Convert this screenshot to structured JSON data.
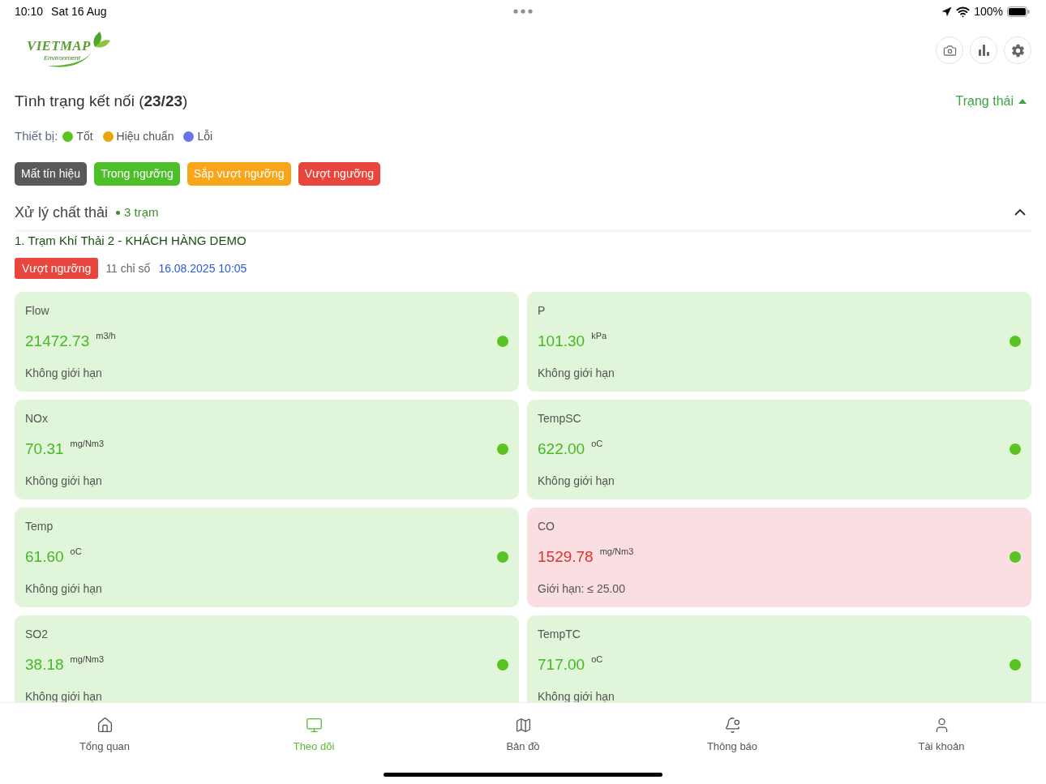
{
  "status_bar": {
    "time": "10:10",
    "date": "Sat 16 Aug",
    "battery": "100%"
  },
  "logo": {
    "wordmark": "VIETMAP",
    "tagline": "Environment"
  },
  "connection": {
    "title": "Tình trạng kết nối (**23/23**)",
    "sort": {
      "label": "Trạng thái",
      "ascending": true
    }
  },
  "device_legend": {
    "label": "Thiết bị:",
    "items": [
      {
        "label": "Tốt",
        "color": "#58c322"
      },
      {
        "label": "Hiệu chuẩn",
        "color": "#e8a50f"
      },
      {
        "label": "Lỗi",
        "color": "#6674f0"
      }
    ]
  },
  "filters": [
    {
      "label": "Mất tín hiệu",
      "color": "#595959"
    },
    {
      "label": "Trong ngưỡng",
      "color": "#4cbf2a"
    },
    {
      "label": "Sắp vượt ngưỡng",
      "color": "#f8a519"
    },
    {
      "label": "Vượt ngưỡng",
      "color": "#e8453c"
    }
  ],
  "group": {
    "title": "Xử lý chất thải",
    "count": "3 trạm",
    "expanded": true
  },
  "station": {
    "title": "1. Trạm Khí Thải 2 - KHÁCH HÀNG DEMO",
    "status": {
      "label": "Vượt ngưỡng",
      "kind": "exceeded"
    },
    "indicators": "11 chỉ số",
    "updated": "16.08.2025 10:05"
  },
  "metrics": [
    {
      "name": "Flow",
      "value": "21472.73",
      "unit": "m3/h",
      "limit": "Không giới hạn",
      "exceeded": false,
      "color": "#58c322"
    },
    {
      "name": "P",
      "value": "101.30",
      "unit": "kPa",
      "limit": "Không giới hạn",
      "exceeded": false,
      "color": "#58c322"
    },
    {
      "name": "NOx",
      "value": "70.31",
      "unit": "mg/Nm3",
      "limit": "Không giới hạn",
      "exceeded": false,
      "color": "#58c322"
    },
    {
      "name": "TempSC",
      "value": "622.00",
      "unit": "oC",
      "limit": "Không giới hạn",
      "exceeded": false,
      "color": "#58c322"
    },
    {
      "name": "Temp",
      "value": "61.60",
      "unit": "oC",
      "limit": "Không giới hạn",
      "exceeded": false,
      "color": "#58c322"
    },
    {
      "name": "CO",
      "value": "1529.78",
      "unit": "mg/Nm3",
      "limit": "Giới hạn: ≤ 25.00",
      "exceeded": true,
      "color": "#58c322"
    },
    {
      "name": "SO2",
      "value": "38.18",
      "unit": "mg/Nm3",
      "limit": "Không giới hạn",
      "exceeded": false,
      "color": "#58c322"
    },
    {
      "name": "TempTC",
      "value": "717.00",
      "unit": "oC",
      "limit": "Không giới hạn",
      "exceeded": false,
      "color": "#58c322"
    }
  ],
  "nav": [
    {
      "label": "Tổng quan",
      "selected": false
    },
    {
      "label": "Theo dõi",
      "selected": true
    },
    {
      "label": "Bản đồ",
      "selected": false
    },
    {
      "label": "Thông báo",
      "selected": false
    },
    {
      "label": "Tài khoản",
      "selected": false
    }
  ]
}
